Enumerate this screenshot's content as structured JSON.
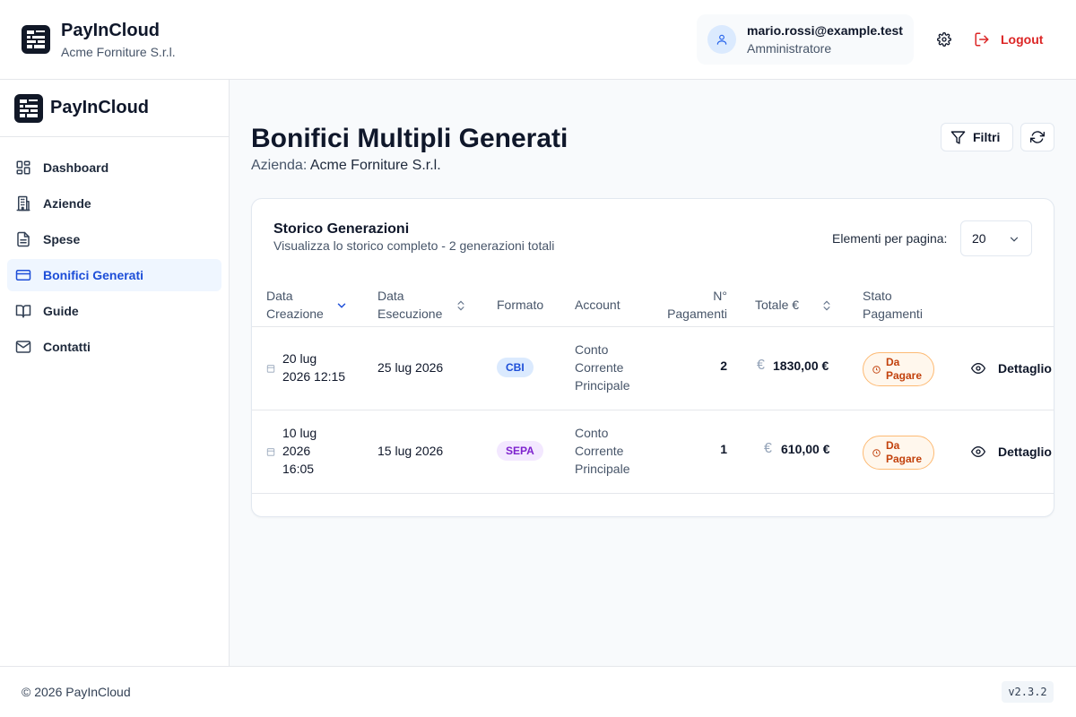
{
  "header": {
    "app_name": "PayInCloud",
    "company": "Acme Forniture S.r.l.",
    "user_email": "mario.rossi@example.test",
    "user_role": "Amministratore",
    "logout_label": "Logout"
  },
  "sidebar": {
    "brand": "PayInCloud",
    "items": [
      {
        "label": "Dashboard",
        "icon": "dashboard-icon",
        "active": false
      },
      {
        "label": "Aziende",
        "icon": "building-icon",
        "active": false
      },
      {
        "label": "Spese",
        "icon": "document-icon",
        "active": false
      },
      {
        "label": "Bonifici Generati",
        "icon": "credit-card-icon",
        "active": true
      },
      {
        "label": "Guide",
        "icon": "book-icon",
        "active": false
      },
      {
        "label": "Contatti",
        "icon": "mail-icon",
        "active": false
      }
    ]
  },
  "page": {
    "title": "Bonifici Multipli Generati",
    "subtitle_prefix": "Azienda:",
    "subtitle_company": "Acme Forniture S.r.l.",
    "filter_label": "Filtri"
  },
  "card": {
    "title": "Storico Generazioni",
    "subtitle": "Visualizza lo storico completo - 2 generazioni totali",
    "per_page_label": "Elementi per pagina:",
    "per_page_value": "20"
  },
  "table": {
    "headers": {
      "data_creazione_1": "Data",
      "data_creazione_2": "Creazione",
      "data_esecuzione_1": "Data",
      "data_esecuzione_2": "Esecuzione",
      "formato": "Formato",
      "account": "Account",
      "n_pagamenti_1": "N°",
      "n_pagamenti_2": "Pagamenti",
      "totale": "Totale €",
      "stato_1": "Stato",
      "stato_2": "Pagamenti"
    },
    "rows": [
      {
        "created_1": "20 lug",
        "created_2": "2026 12:15",
        "created_3": "",
        "executed": "25 lug 2026",
        "format": "CBI",
        "account_1": "Conto",
        "account_2": "Corrente",
        "account_3": "Principale",
        "count": "2",
        "currency": "€",
        "total": "1830,00 €",
        "status_1": "Da",
        "status_2": "Pagare",
        "action": "Dettaglio"
      },
      {
        "created_1": "10 lug",
        "created_2": "2026",
        "created_3": "16:05",
        "executed": "15 lug 2026",
        "format": "SEPA",
        "account_1": "Conto",
        "account_2": "Corrente",
        "account_3": "Principale",
        "count": "1",
        "currency": "€",
        "total": "610,00 €",
        "status_1": "Da",
        "status_2": "Pagare",
        "action": "Dettaglio"
      }
    ]
  },
  "footer": {
    "copyright": "© 2026 PayInCloud",
    "version": "v2.3.2"
  },
  "colors": {
    "primary": "#1d4ed8",
    "danger": "#dc2626",
    "warning": "#c2410c"
  }
}
